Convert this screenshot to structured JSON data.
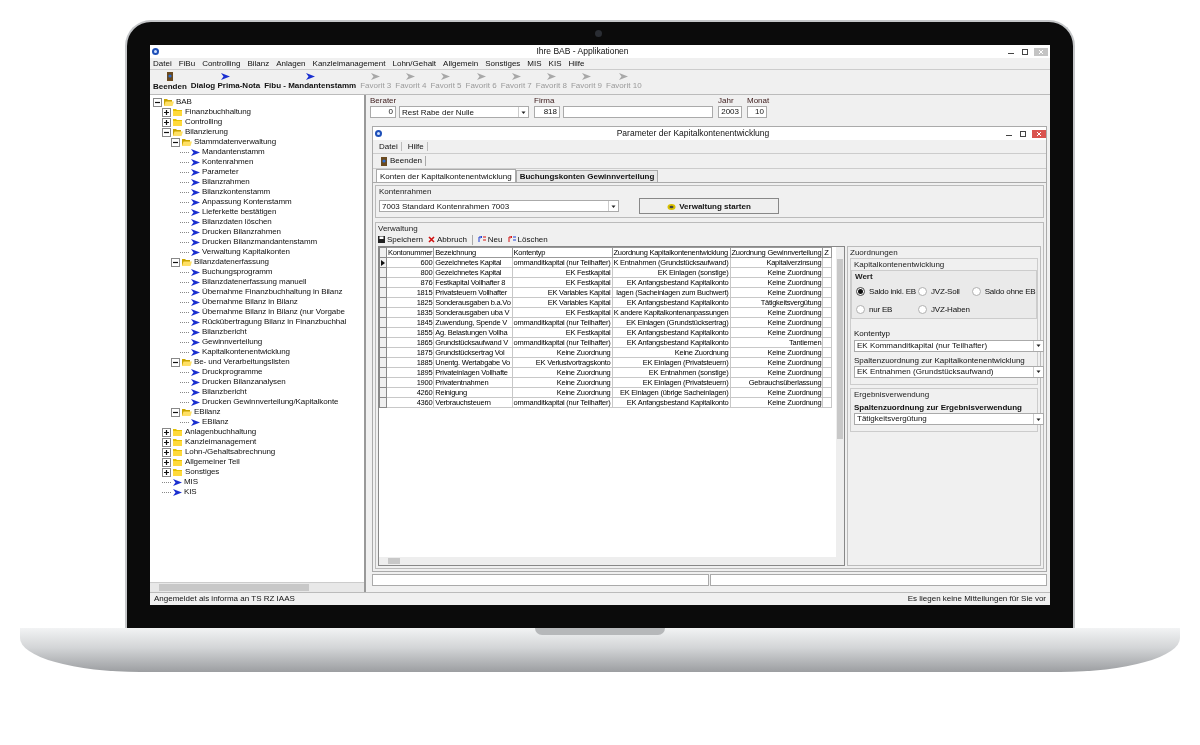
{
  "window": {
    "title": "Ihre BAB - Applikationen"
  },
  "menu": [
    "Datei",
    "FiBu",
    "Controlling",
    "Bilanz",
    "Anlagen",
    "Kanzleimanagement",
    "Lohn/Gehalt",
    "Allgemein",
    "Sonstiges",
    "MIS",
    "KIS",
    "Hilfe"
  ],
  "toolbar": [
    {
      "label": "Beenden",
      "kind": "exit",
      "disabled": false
    },
    {
      "label": "Dialog Prima-Nota",
      "kind": "arrow",
      "disabled": false
    },
    {
      "label": "Fibu - Mandantenstamm",
      "kind": "arrow",
      "disabled": false
    },
    {
      "label": "Favorit 3",
      "kind": "arrow",
      "disabled": true
    },
    {
      "label": "Favorit 4",
      "kind": "arrow",
      "disabled": true
    },
    {
      "label": "Favorit 5",
      "kind": "arrow",
      "disabled": true
    },
    {
      "label": "Favorit 6",
      "kind": "arrow",
      "disabled": true
    },
    {
      "label": "Favorit 7",
      "kind": "arrow",
      "disabled": true
    },
    {
      "label": "Favorit 8",
      "kind": "arrow",
      "disabled": true
    },
    {
      "label": "Favorit 9",
      "kind": "arrow",
      "disabled": true
    },
    {
      "label": "Favorit 10",
      "kind": "arrow",
      "disabled": true
    }
  ],
  "tree": [
    {
      "label": "BAB",
      "kind": "folder",
      "expanded": true,
      "children": [
        {
          "label": "Finanzbuchhaltung",
          "kind": "folder",
          "expanded": false
        },
        {
          "label": "Controlling",
          "kind": "folder",
          "expanded": false
        },
        {
          "label": "Bilanzierung",
          "kind": "folder",
          "expanded": true,
          "children": [
            {
              "label": "Stammdatenverwaltung",
              "kind": "folder",
              "expanded": true,
              "children": [
                {
                  "label": "Mandantenstamm",
                  "kind": "leaf"
                },
                {
                  "label": "Kontenrahmen",
                  "kind": "leaf"
                },
                {
                  "label": "Parameter",
                  "kind": "leaf"
                },
                {
                  "label": "Bilanzrahmen",
                  "kind": "leaf"
                },
                {
                  "label": "Bilanzkontenstamm",
                  "kind": "leaf"
                },
                {
                  "label": "Anpassung Kontenstamm",
                  "kind": "leaf"
                },
                {
                  "label": "Lieferkette bestätigen",
                  "kind": "leaf"
                },
                {
                  "label": "Bilanzdaten löschen",
                  "kind": "leaf"
                },
                {
                  "label": "Drucken Bilanzrahmen",
                  "kind": "leaf"
                },
                {
                  "label": "Drucken Bilanzmandantenstamm",
                  "kind": "leaf"
                },
                {
                  "label": "Verwaltung Kapitalkonten",
                  "kind": "leaf"
                }
              ]
            },
            {
              "label": "Bilanzdatenerfassung",
              "kind": "folder",
              "expanded": true,
              "children": [
                {
                  "label": "Buchungsprogramm",
                  "kind": "leaf"
                },
                {
                  "label": "Bilanzdatenerfassung manuell",
                  "kind": "leaf"
                },
                {
                  "label": "Übernahme Finanzbuchhaltung in Bilanz",
                  "kind": "leaf"
                },
                {
                  "label": "Übernahme Bilanz in Bilanz",
                  "kind": "leaf"
                },
                {
                  "label": "Übernahme Bilanz in Bilanz (nur Vorgabe",
                  "kind": "leaf"
                },
                {
                  "label": "Rückübertragung Bilanz in Finanzbuchhal",
                  "kind": "leaf"
                },
                {
                  "label": "Bilanzbericht",
                  "kind": "leaf"
                },
                {
                  "label": "Gewinnverteilung",
                  "kind": "leaf"
                },
                {
                  "label": "Kapitalkontenentwicklung",
                  "kind": "leaf"
                }
              ]
            },
            {
              "label": "Be- und Verarbeitungslisten",
              "kind": "folder",
              "expanded": true,
              "children": [
                {
                  "label": "Druckprogramme",
                  "kind": "leaf"
                },
                {
                  "label": "Drucken Bilanzanalysen",
                  "kind": "leaf"
                },
                {
                  "label": "Bilanzbericht",
                  "kind": "leaf"
                },
                {
                  "label": "Drucken Gewinnverteilung/Kapitalkonte",
                  "kind": "leaf"
                }
              ]
            },
            {
              "label": "EBilanz",
              "kind": "folder",
              "expanded": true,
              "children": [
                {
                  "label": "EBilanz",
                  "kind": "leaf"
                }
              ]
            }
          ]
        },
        {
          "label": "Anlagenbuchhaltung",
          "kind": "folder",
          "expanded": false
        },
        {
          "label": "Kanzleimanagement",
          "kind": "folder",
          "expanded": false
        },
        {
          "label": "Lohn-/Gehaltsabrechnung",
          "kind": "folder",
          "expanded": false
        },
        {
          "label": "Allgemeiner Teil",
          "kind": "folder",
          "expanded": false
        },
        {
          "label": "Sonstiges",
          "kind": "folder",
          "expanded": false
        },
        {
          "label": "MIS",
          "kind": "leaf"
        },
        {
          "label": "KIS",
          "kind": "leaf"
        }
      ]
    }
  ],
  "header_fields": {
    "berater_label": "Berater",
    "berater_number": "0",
    "berater_name": "Rest Rabe der Nulle",
    "firma_label": "Firma",
    "firma_number": "818",
    "jahr_label": "Jahr",
    "jahr": "2003",
    "monat_label": "Monat",
    "monat": "10"
  },
  "dialog": {
    "title": "Parameter der Kapitalkontenentwicklung",
    "menu": [
      "Datei",
      "Hilfe"
    ],
    "toolbar": [
      "Beenden"
    ],
    "tabs": [
      {
        "label": "Konten der Kapitalkontenentwicklung",
        "selected": true
      },
      {
        "label": "Buchungskonten Gewinnverteilung",
        "selected": false
      }
    ],
    "kontenrahmen": {
      "title": "Kontenrahmen",
      "value": "7003 Standard Kontenrahmen 7003",
      "button": "Verwaltung starten"
    },
    "verwaltung": {
      "title": "Verwaltung",
      "actions": [
        {
          "label": "Speichern",
          "kind": "save"
        },
        {
          "label": "Abbruch",
          "kind": "cancel"
        },
        {
          "label": "Neu",
          "kind": "new"
        },
        {
          "label": "Löschen",
          "kind": "delete"
        }
      ]
    },
    "table": {
      "columns": [
        "Kontonummer",
        "Bezeichnung",
        "Kontentyp",
        "Zuordnung Kapitalkontenentwicklung",
        "Zuordnung Gewinnverteilung",
        "Z"
      ],
      "rows": [
        {
          "selected": true,
          "cells": [
            "600",
            "Gezeichnetes Kapital",
            "ommanditkapital (nur Teilhafter)",
            "K Entnahmen (Grundstücksaufwand)",
            "Kapitalverzinsung"
          ]
        },
        {
          "selected": false,
          "cells": [
            "800",
            "Gezeichnetes Kapital",
            "EK Festkapital",
            "EK Einlagen (sonstige)",
            "Keine Zuordnung"
          ]
        },
        {
          "selected": false,
          "cells": [
            "876",
            "Festkapital Vollhafter 8",
            "EK Festkapital",
            "EK Anfangsbestand Kapitalkonto",
            "Keine Zuordnung"
          ]
        },
        {
          "selected": false,
          "cells": [
            "1815",
            "Privatsteuern Vollhafter",
            "EK Variables Kapital",
            "lagen (Sacheinlagen zum Buchwert)",
            "Keine Zuordnung"
          ]
        },
        {
          "selected": false,
          "cells": [
            "1825",
            "Sonderausgaben b.a.Vo",
            "EK Variables Kapital",
            "EK Anfangsbestand Kapitalkonto",
            "Tätigkeitsvergütung"
          ]
        },
        {
          "selected": false,
          "cells": [
            "1835",
            "Sonderausgaben uba V",
            "EK Festkapital",
            "K andere Kapitalkontenanpassungen",
            "Keine Zuordnung"
          ]
        },
        {
          "selected": false,
          "cells": [
            "1845",
            "Zuwendung, Spende V",
            "ommanditkapital (nur Teilhafter)",
            "EK Einlagen (Grundstücksertrag)",
            "Keine Zuordnung"
          ]
        },
        {
          "selected": false,
          "cells": [
            "1855",
            "Ag. Belastungen Vollha",
            "EK Festkapital",
            "EK Anfangsbestand Kapitalkonto",
            "Keine Zuordnung"
          ]
        },
        {
          "selected": false,
          "cells": [
            "1865",
            "Grundstücksaufwand V",
            "ommanditkapital (nur Teilhafter)",
            "EK Anfangsbestand Kapitalkonto",
            "Tantiemen"
          ]
        },
        {
          "selected": false,
          "cells": [
            "1875",
            "Grundstücksertrag Vol",
            "Keine Zuordnung",
            "Keine Zuordnung",
            "Keine Zuordnung"
          ]
        },
        {
          "selected": false,
          "cells": [
            "1885",
            "Unentg. Wertabgabe Vo",
            "EK Verlustvortragskonto",
            "EK Einlagen (Privatsteuern)",
            "Keine Zuordnung"
          ]
        },
        {
          "selected": false,
          "cells": [
            "1895",
            "Privateinlagen Vollhafte",
            "Keine Zuordnung",
            "EK Entnahmen (sonstige)",
            "Keine Zuordnung"
          ]
        },
        {
          "selected": false,
          "cells": [
            "1900",
            "Privatentnahmen",
            "Keine Zuordnung",
            "EK Einlagen (Privatsteuern)",
            "Gebrauchsüberlassung"
          ]
        },
        {
          "selected": false,
          "cells": [
            "4260",
            "Reinigung",
            "Keine Zuordnung",
            "EK Einlagen (übrige Sacheinlagen)",
            "Keine Zuordnung"
          ]
        },
        {
          "selected": false,
          "cells": [
            "4360",
            "Verbrauchsteuern",
            "ommanditkapital (nur Teilhafter)",
            "EK Anfangsbestand Kapitalkonto",
            "Keine Zuordnung"
          ]
        }
      ]
    },
    "zuordnungen": {
      "title": "Zuordnungen",
      "kapital_title": "Kapitalkontenentwicklung",
      "wert_title": "Wert",
      "wert_options": [
        {
          "label": "Saldo inkl. EB",
          "selected": true
        },
        {
          "label": "JVZ-Soll",
          "selected": false
        },
        {
          "label": "Saldo ohne EB",
          "selected": false
        },
        {
          "label": "nur EB",
          "selected": false
        },
        {
          "label": "JVZ-Haben",
          "selected": false
        }
      ],
      "kontentyp_label": "Kontentyp",
      "kontentyp": "EK Kommanditkapital (nur Teilhafter)",
      "spalte_label": "Spaltenzuordnung zur Kapitalkontenentwicklung",
      "spalte": "EK Entnahmen (Grundstücksaufwand)",
      "ergebnis_title": "Ergebnisverwendung",
      "ergebnis_label": "Spaltenzuordnung zur Ergebnisverwendung",
      "ergebnis": "Tätigkeitsvergütung"
    }
  },
  "status_bar": {
    "left": "Angemeldet als informa an TS RZ IAAS",
    "right": "Es liegen keine Mitteilungen für Sie vor"
  }
}
